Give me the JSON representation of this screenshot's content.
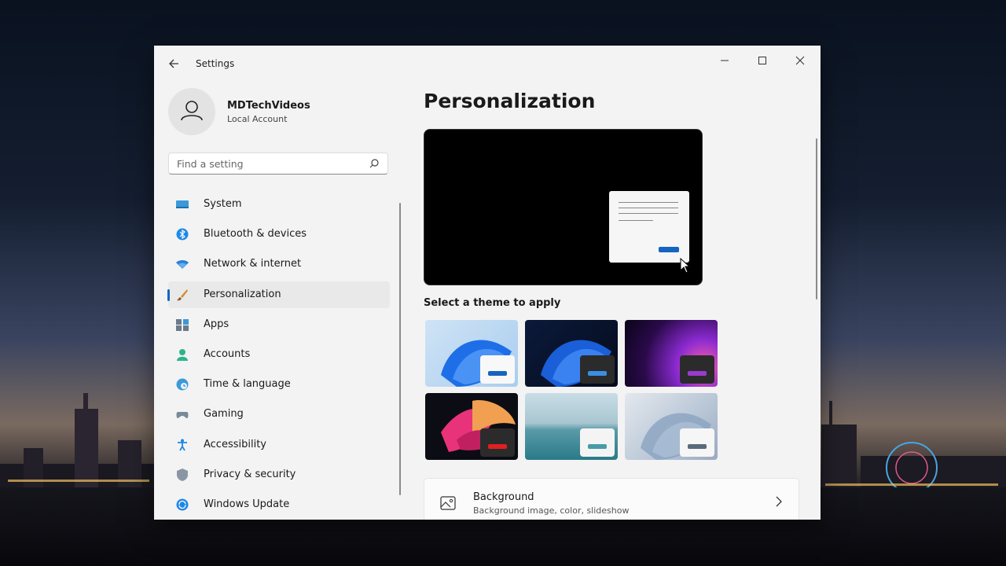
{
  "app": {
    "title": "Settings"
  },
  "profile": {
    "name": "MDTechVideos",
    "account_type": "Local Account"
  },
  "search": {
    "placeholder": "Find a setting"
  },
  "sidebar": {
    "items": [
      {
        "label": "System",
        "icon": "monitor-icon"
      },
      {
        "label": "Bluetooth & devices",
        "icon": "bluetooth-icon"
      },
      {
        "label": "Network & internet",
        "icon": "wifi-icon"
      },
      {
        "label": "Personalization",
        "icon": "brush-icon",
        "selected": true
      },
      {
        "label": "Apps",
        "icon": "apps-icon"
      },
      {
        "label": "Accounts",
        "icon": "person-icon"
      },
      {
        "label": "Time & language",
        "icon": "globe-clock-icon"
      },
      {
        "label": "Gaming",
        "icon": "gamepad-icon"
      },
      {
        "label": "Accessibility",
        "icon": "accessibility-icon"
      },
      {
        "label": "Privacy & security",
        "icon": "shield-icon"
      },
      {
        "label": "Windows Update",
        "icon": "update-icon"
      }
    ]
  },
  "main": {
    "title": "Personalization",
    "themes_label": "Select a theme to apply",
    "themes": [
      {
        "name": "windows-light"
      },
      {
        "name": "windows-dark"
      },
      {
        "name": "glow"
      },
      {
        "name": "captured-motion"
      },
      {
        "name": "sunrise"
      },
      {
        "name": "flow"
      }
    ],
    "background_card": {
      "title": "Background",
      "subtitle": "Background image, color, slideshow"
    }
  },
  "colors": {
    "accent": "#1565c0",
    "window_bg": "#f3f3f3"
  }
}
